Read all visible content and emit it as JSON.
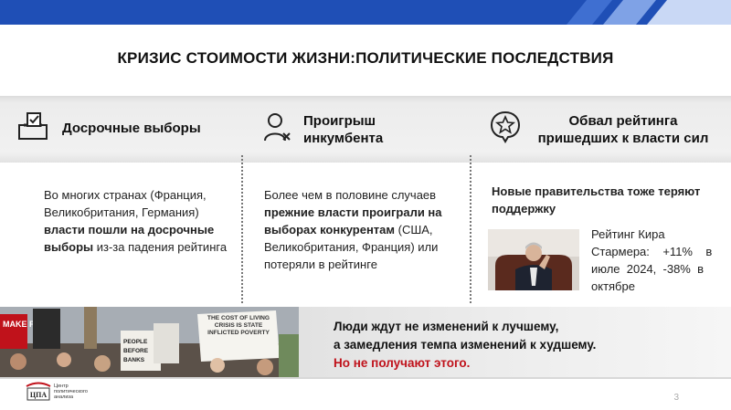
{
  "slide": {
    "title": "КРИЗИС СТОИМОСТИ ЖИЗНИ:ПОЛИТИЧЕСКИЕ ПОСЛЕДСТВИЯ",
    "page_number": "3"
  },
  "columns": [
    {
      "heading": "Досрочные выборы",
      "icon": "ballot-box-icon",
      "text_1": "Во многих странах (Франция, Великобритания, Германия) ",
      "text_bold": "власти пошли на досрочные выборы",
      "text_2": " из-за падения рейтинга"
    },
    {
      "heading_line1": "Проигрыш",
      "heading_line2": "инкумбента",
      "icon": "user-x-icon",
      "text_1": "Более чем в половине случаев ",
      "text_bold": "прежние власти проиграли на выборах конкурентам",
      "text_2": " (США, Великобритания, Франция) или потеряли в рейтинге"
    },
    {
      "heading_line1": "Обвал рейтинга",
      "heading_line2": "пришедших к власти сил",
      "icon": "star-badge-icon",
      "subheading": "Новые правительства тоже теряют поддержку",
      "rating_line1": "Рейтинг Кира",
      "rating_line2": "Стармера:    +11%    в",
      "rating_line3": "июле  2024,  -38%  в",
      "rating_line4": "октябре"
    }
  ],
  "quote": {
    "line1": "Люди ждут не изменений к лучшему,",
    "line2": "а замедления темпа изменений к худшему.",
    "line3": "Но не получают этого."
  },
  "protest_signs": {
    "sign1": "THE COST OF LIVING CRISIS IS STATE INFLICTED POVERTY",
    "sign2": "PEOPLE BEFORE BANKS",
    "sign3": "MAKE PAY"
  },
  "footer": {
    "logo_letters": "ЦПА",
    "logo_caption": "Центр политического анализа"
  },
  "colors": {
    "brand_blue": "#1f4fb6",
    "accent_red": "#c0121b"
  }
}
